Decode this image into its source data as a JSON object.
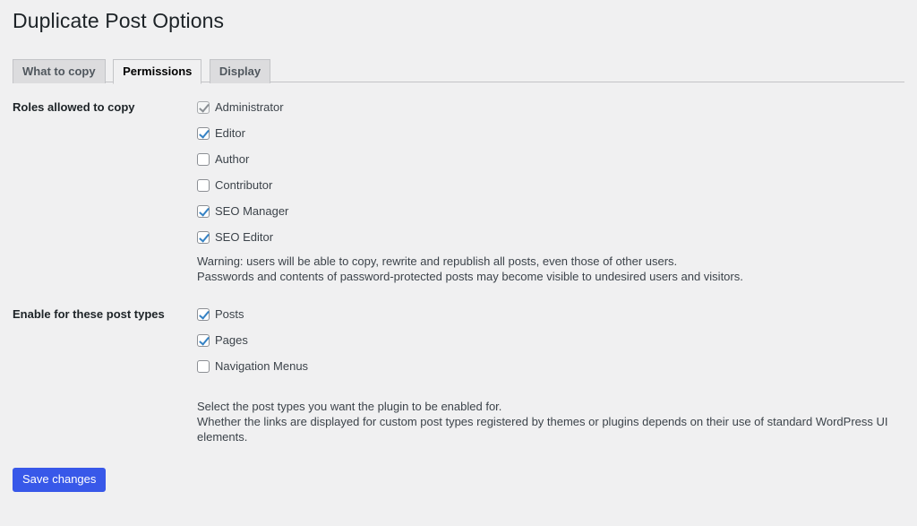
{
  "page": {
    "title": "Duplicate Post Options"
  },
  "tabs": [
    {
      "label": "What to copy",
      "active": false
    },
    {
      "label": "Permissions",
      "active": true
    },
    {
      "label": "Display",
      "active": false
    }
  ],
  "sections": {
    "roles": {
      "label": "Roles allowed to copy",
      "checkboxes": [
        {
          "label": "Administrator",
          "checked": true,
          "dim": true
        },
        {
          "label": "Editor",
          "checked": true,
          "dim": false
        },
        {
          "label": "Author",
          "checked": false,
          "dim": false
        },
        {
          "label": "Contributor",
          "checked": false,
          "dim": false
        },
        {
          "label": "SEO Manager",
          "checked": true,
          "dim": false
        },
        {
          "label": "SEO Editor",
          "checked": true,
          "dim": false
        }
      ],
      "help_line_1": "Warning: users will be able to copy, rewrite and republish all posts, even those of other users.",
      "help_line_2": "Passwords and contents of password-protected posts may become visible to undesired users and visitors."
    },
    "post_types": {
      "label": "Enable for these post types",
      "checkboxes": [
        {
          "label": "Posts",
          "checked": true,
          "dim": false
        },
        {
          "label": "Pages",
          "checked": true,
          "dim": false
        },
        {
          "label": "Navigation Menus",
          "checked": false,
          "dim": false
        }
      ],
      "help_line_1": "Select the post types you want the plugin to be enabled for.",
      "help_line_2": "Whether the links are displayed for custom post types registered by themes or plugins depends on their use of standard WordPress UI elements."
    }
  },
  "submit": {
    "save_label": "Save changes"
  },
  "colors": {
    "background": "#f0f0f1",
    "primary_button": "#3858e9",
    "checkbox_check": "#3582c4",
    "tab_inactive": "#dcdcde",
    "border": "#c3c4c7",
    "text": "#3c434a",
    "heading": "#1d2327"
  }
}
